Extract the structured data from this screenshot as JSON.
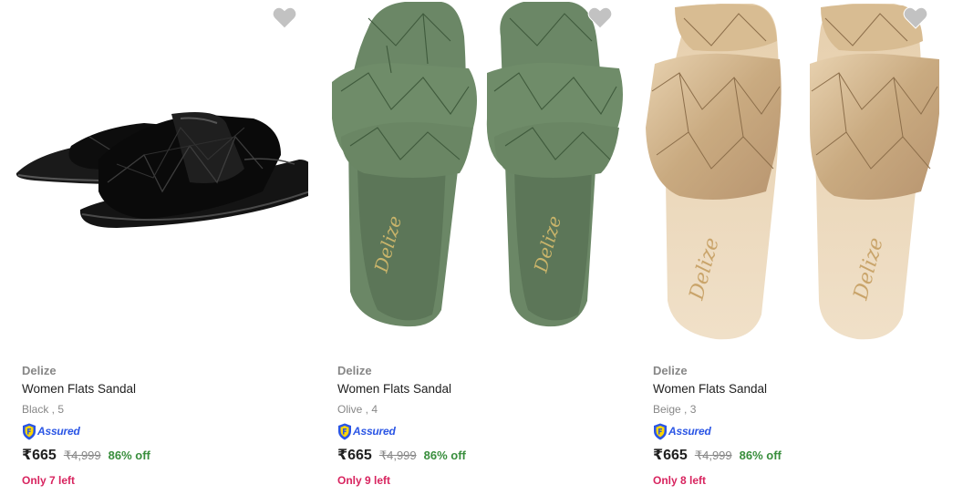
{
  "colors": {
    "brand_text": "#878787",
    "title_text": "#212121",
    "assured_blue": "#2a55e5",
    "discount_green": "#388e3c",
    "stock_red": "#d8245f",
    "wishlist_heart": "#c2c2c2"
  },
  "products": [
    {
      "brand": "Delize",
      "title": "Women Flats Sandal",
      "variant": "Black , 5",
      "assured": "Assured",
      "price": "₹665",
      "mrp": "₹4,999",
      "discount": "86% off",
      "stock": "Only 7 left",
      "image_icon": "black-quilted-sandal-image",
      "wishlist_icon": "heart-icon"
    },
    {
      "brand": "Delize",
      "title": "Women Flats Sandal",
      "variant": "Olive , 4",
      "assured": "Assured",
      "price": "₹665",
      "mrp": "₹4,999",
      "discount": "86% off",
      "stock": "Only 9 left",
      "image_icon": "olive-quilted-sandal-image",
      "wishlist_icon": "heart-icon"
    },
    {
      "brand": "Delize",
      "title": "Women Flats Sandal",
      "variant": "Beige , 3",
      "assured": "Assured",
      "price": "₹665",
      "mrp": "₹4,999",
      "discount": "86% off",
      "stock": "Only 8 left",
      "image_icon": "beige-quilted-sandal-image",
      "wishlist_icon": "heart-icon"
    }
  ]
}
